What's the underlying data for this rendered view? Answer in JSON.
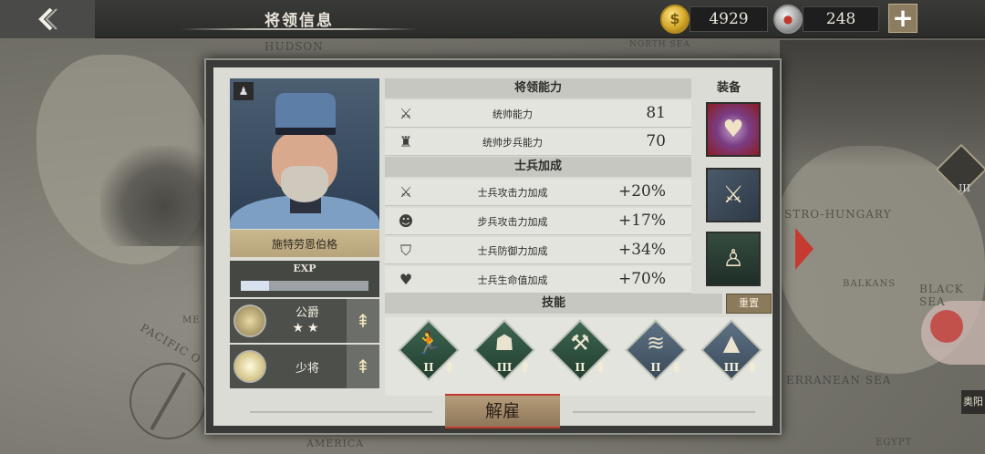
{
  "header": {
    "title": "将领信息",
    "gold_amount": "4929",
    "gold_icon_symbol": "$",
    "medal_amount": "248",
    "plus_label": "+",
    "back_icon": "chevron-left-icon"
  },
  "map": {
    "labels": [
      "HUDSON",
      "NORTH SEA",
      "STRO-HUNGARY",
      "BALKANS",
      "BLACK SEA",
      "ERRANEAN SEA",
      "PACIFIC O",
      "AMERICA",
      "EGYPT",
      "ME"
    ],
    "badge_label": "III",
    "corner_tag": "奥阳"
  },
  "general": {
    "name": "施特劳恩伯格",
    "exp_label": "EXP",
    "exp_fraction": 0.22,
    "title_rank": "公爵",
    "title_stars": "★★",
    "military_rank": "少将",
    "upgrade_symbol": "⇞"
  },
  "abilities": {
    "header": "将领能力",
    "rows": [
      {
        "icon": "crossed-swords-icon",
        "label": "统帅能力",
        "value": "81"
      },
      {
        "icon": "infantry-soldier-icon",
        "label": "统帅步兵能力",
        "value": "70"
      }
    ]
  },
  "bonuses": {
    "header": "士兵加成",
    "rows": [
      {
        "icon": "attack-swords-icon",
        "label": "士兵攻击力加成",
        "value": "+20%"
      },
      {
        "icon": "infantry-attack-icon",
        "label": "步兵攻击力加成",
        "value": "+17%"
      },
      {
        "icon": "shield-icon",
        "label": "士兵防御力加成",
        "value": "+34%"
      },
      {
        "icon": "heart-icon",
        "label": "士兵生命值加成",
        "value": "+70%"
      }
    ]
  },
  "equipment": {
    "header": "装备",
    "items": [
      "purple-heart-medal-icon",
      "sabre-icon",
      "uniform-icon"
    ]
  },
  "skills": {
    "header": "技能",
    "reset_label": "重置",
    "items": [
      {
        "icon": "running-soldier-icon",
        "level": "II"
      },
      {
        "icon": "soldier-bust-icon",
        "level": "III"
      },
      {
        "icon": "crawling-soldier-icon",
        "level": "II"
      },
      {
        "icon": "trench-wire-icon",
        "level": "II"
      },
      {
        "icon": "mountains-icon",
        "level": "III"
      }
    ]
  },
  "dismiss_label": "解雇",
  "colors": {
    "topbar": "#2b2c2a",
    "panel": "#dcdcd6",
    "accent_red": "#c13a2f",
    "gold": "#d4a82a",
    "skill_green": "#3d6650"
  }
}
